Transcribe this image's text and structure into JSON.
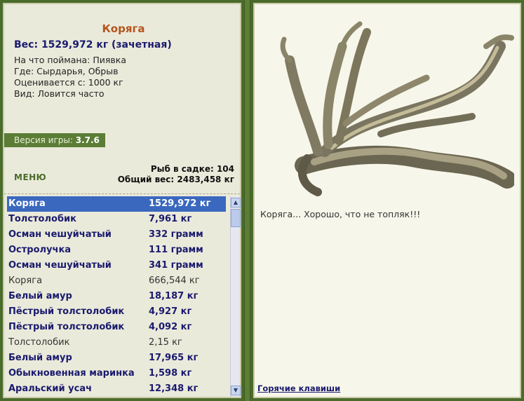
{
  "fish": {
    "name": "Коряга",
    "weight": "Вес: 1529,972 кг (зачетная)",
    "caught_on": "На что поймана: Пиявка",
    "where": "Где: Сырдарья, Обрыв",
    "valued": "Оценивается с: 1000 кг",
    "kind": "Вид: Ловится часто"
  },
  "version": {
    "label": "Версия игры:",
    "value": "3.7.6"
  },
  "menu_label": "МЕНЮ",
  "stats": {
    "fish_count": "Рыб в садке: 104",
    "total_weight": "Общий вес: 2483,458 кг"
  },
  "catch_list": [
    {
      "name": "Коряга",
      "weight": "1529,972 кг",
      "style": "selected"
    },
    {
      "name": "Толстолобик",
      "weight": "7,961 кг",
      "style": "bold"
    },
    {
      "name": "Осман чешуйчатый",
      "weight": "332 грамм",
      "style": "bold"
    },
    {
      "name": "Остролучка",
      "weight": "111 грамм",
      "style": "bold"
    },
    {
      "name": "Осман чешуйчатый",
      "weight": "341 грамм",
      "style": "bold"
    },
    {
      "name": "Коряга",
      "weight": "666,544 кг",
      "style": "plain"
    },
    {
      "name": "Белый амур",
      "weight": "18,187 кг",
      "style": "bold"
    },
    {
      "name": "Пёстрый толстолобик",
      "weight": "4,927 кг",
      "style": "bold"
    },
    {
      "name": "Пёстрый толстолобик",
      "weight": "4,092 кг",
      "style": "bold"
    },
    {
      "name": "Толстолобик",
      "weight": "2,15 кг",
      "style": "plain"
    },
    {
      "name": "Белый амур",
      "weight": "17,965 кг",
      "style": "bold"
    },
    {
      "name": "Обыкновенная маринка",
      "weight": "1,598 кг",
      "style": "bold"
    },
    {
      "name": "Аральский усач",
      "weight": "12,348 кг",
      "style": "bold"
    }
  ],
  "comment": "Коряга... Хорошо, что не топляк!!!",
  "hotkeys_label": "Горячие клавиши",
  "icons": {
    "scroll_up": "▲",
    "scroll_down": "▼"
  }
}
